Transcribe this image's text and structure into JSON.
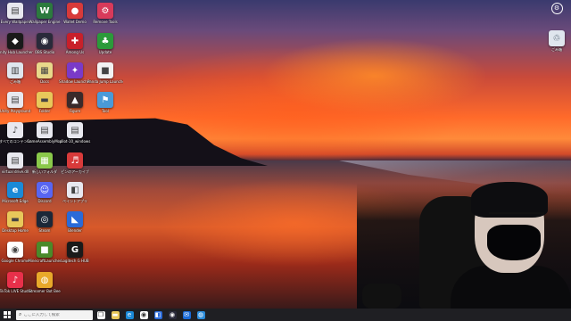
{
  "desktop": {
    "icons": [
      {
        "label": "Every Wallpaper",
        "color": "#e8e8ef",
        "glyph": "▤",
        "col": 0,
        "row": 0
      },
      {
        "label": "Wallpaper Engine",
        "color": "#2c7a3e",
        "glyph": "W",
        "col": 1,
        "row": 0
      },
      {
        "label": "Wallet Demo",
        "color": "#d83a3a",
        "glyph": "●",
        "col": 2,
        "row": 0
      },
      {
        "label": "Remove Tools",
        "color": "#d83a5a",
        "glyph": "⚙",
        "col": 3,
        "row": 0
      },
      {
        "label": "Unity Hub Launcher",
        "color": "#1a1a1a",
        "glyph": "◆",
        "col": 0,
        "row": 1
      },
      {
        "label": "OBS Studio",
        "color": "#2a2a3a",
        "glyph": "◉",
        "col": 1,
        "row": 1
      },
      {
        "label": "Among Us",
        "color": "#c8202a",
        "glyph": "✚",
        "col": 2,
        "row": 1
      },
      {
        "label": "Update",
        "color": "#2b9a3a",
        "glyph": "♣",
        "col": 3,
        "row": 1
      },
      {
        "label": "ごみ箱",
        "color": "#dfe6ee",
        "glyph": "▥",
        "col": 0,
        "row": 2
      },
      {
        "label": "Docs",
        "color": "#e8d88a",
        "glyph": "▦",
        "col": 1,
        "row": 2
      },
      {
        "label": "Shadow Launcher",
        "color": "#7a3ac8",
        "glyph": "✦",
        "col": 2,
        "row": 2
      },
      {
        "label": "Panda Jump Launcher",
        "color": "#f2f2f2",
        "glyph": "■",
        "col": 3,
        "row": 2
      },
      {
        "label": "Unity Playground",
        "color": "#e8e8ef",
        "glyph": "▤",
        "col": 0,
        "row": 3
      },
      {
        "label": "Folder",
        "color": "#e8c85a",
        "glyph": "▬",
        "col": 1,
        "row": 3
      },
      {
        "label": "Figure",
        "color": "#3a2a2a",
        "glyph": "▲",
        "col": 2,
        "row": 3
      },
      {
        "label": "Tool",
        "color": "#4a9ad8",
        "glyph": "⚑",
        "col": 3,
        "row": 3
      },
      {
        "label": "すべてのコンテンツ",
        "color": "#e8e8ef",
        "glyph": "♪",
        "col": 0,
        "row": 4
      },
      {
        "label": "GameAssemblyModil",
        "color": "#e8e8ef",
        "glyph": "▤",
        "col": 1,
        "row": 4
      },
      {
        "label": "pilot-10_windows",
        "color": "#e8e8ef",
        "glyph": "▤",
        "col": 2,
        "row": 4
      },
      {
        "label": "virtual drive.dll",
        "color": "#e8e8ef",
        "glyph": "▤",
        "col": 0,
        "row": 5
      },
      {
        "label": "新しいフォルダ",
        "color": "#8ac84a",
        "glyph": "▦",
        "col": 1,
        "row": 5
      },
      {
        "label": "ピンのアーカイブ",
        "color": "#d83a3a",
        "glyph": "♬",
        "col": 2,
        "row": 5
      },
      {
        "label": "Microsoft Edge",
        "color": "#1a8ad8",
        "glyph": "e",
        "col": 0,
        "row": 6
      },
      {
        "label": "Discord",
        "color": "#5865f2",
        "glyph": "☺",
        "col": 1,
        "row": 6
      },
      {
        "label": "ペイントアプリ",
        "color": "#e8e8ef",
        "glyph": "◧",
        "col": 2,
        "row": 6
      },
      {
        "label": "Desktop Home",
        "color": "#e8c85a",
        "glyph": "▬",
        "col": 0,
        "row": 7
      },
      {
        "label": "Steam",
        "color": "#1b2838",
        "glyph": "◎",
        "col": 1,
        "row": 7
      },
      {
        "label": "Blender",
        "color": "#2a6ad8",
        "glyph": "◣",
        "col": 2,
        "row": 7
      },
      {
        "label": "Google Chrome",
        "color": "#ffffff",
        "glyph": "◉",
        "col": 0,
        "row": 8
      },
      {
        "label": "MinecraftLauncher",
        "color": "#4a8a2a",
        "glyph": "■",
        "col": 1,
        "row": 8
      },
      {
        "label": "Logitech G HUB",
        "color": "#1a1a1a",
        "glyph": "G",
        "col": 2,
        "row": 8
      },
      {
        "label": "TikTok LIVE Studio",
        "color": "#e8304a",
        "glyph": "♪",
        "col": 0,
        "row": 9
      },
      {
        "label": "Streamer Bot Bee",
        "color": "#e8a82a",
        "glyph": "◍",
        "col": 1,
        "row": 9
      }
    ],
    "recycle_bin_label": "ごみ箱",
    "settings_icon": "settings-circle-icon"
  },
  "taskbar": {
    "search_placeholder": "ここに入力して検索",
    "apps": [
      {
        "name": "task-view-icon",
        "color": "#ffffff",
        "glyph": "❐"
      },
      {
        "name": "file-explorer-icon",
        "color": "#e8c85a",
        "glyph": "▬"
      },
      {
        "name": "edge-icon",
        "color": "#1a8ad8",
        "glyph": "e"
      },
      {
        "name": "chrome-icon",
        "color": "#ffffff",
        "glyph": "◉"
      },
      {
        "name": "store-icon",
        "color": "#2a6ad8",
        "glyph": "◧"
      },
      {
        "name": "obs-icon",
        "color": "#2a2a3a",
        "glyph": "◉"
      },
      {
        "name": "mail-icon",
        "color": "#1a6ad8",
        "glyph": "✉"
      },
      {
        "name": "windows-app-icon",
        "color": "#2a8ad8",
        "glyph": "◍"
      }
    ]
  }
}
